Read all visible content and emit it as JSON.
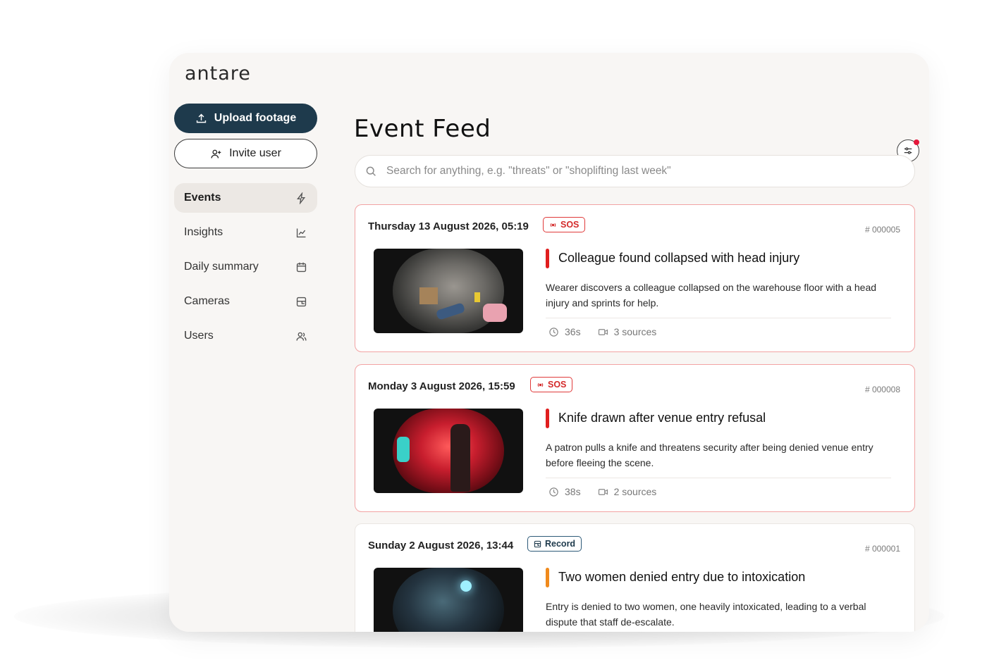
{
  "app": {
    "logo": "antare"
  },
  "sidebar": {
    "upload_label": "Upload footage",
    "invite_label": "Invite user",
    "items": [
      {
        "label": "Events",
        "icon": "bolt-icon",
        "active": true
      },
      {
        "label": "Insights",
        "icon": "chart-icon",
        "active": false
      },
      {
        "label": "Daily summary",
        "icon": "calendar-icon",
        "active": false
      },
      {
        "label": "Cameras",
        "icon": "camera-icon",
        "active": false
      },
      {
        "label": "Users",
        "icon": "users-icon",
        "active": false
      }
    ]
  },
  "main": {
    "title": "Event Feed",
    "search_placeholder": "Search for anything, e.g. \"threats\" or \"shoplifting last week\"",
    "events": [
      {
        "date": "Thursday 13 August 2026, 05:19",
        "badge": "SOS",
        "id": "# 000005",
        "title": "Colleague found collapsed with head injury",
        "description": "Wearer discovers a colleague collapsed on the warehouse floor with a head injury and sprints for help.",
        "duration": "36s",
        "sources": "3 sources",
        "severity_color": "#e01e1e"
      },
      {
        "date": "Monday 3 August 2026, 15:59",
        "badge": "SOS",
        "id": "# 000008",
        "title": "Knife drawn after venue entry refusal",
        "description": "A patron pulls a knife and threatens security after being denied venue entry before fleeing the scene.",
        "duration": "38s",
        "sources": "2 sources",
        "severity_color": "#e01e1e"
      },
      {
        "date": "Sunday 2 August 2026, 13:44",
        "badge": "Record",
        "id": "# 000001",
        "title": "Two women denied entry due to intoxication",
        "description": "Entry is denied to two women, one heavily intoxicated, leading to a verbal dispute that staff de-escalate.",
        "severity_color": "#f08a1c"
      }
    ]
  }
}
